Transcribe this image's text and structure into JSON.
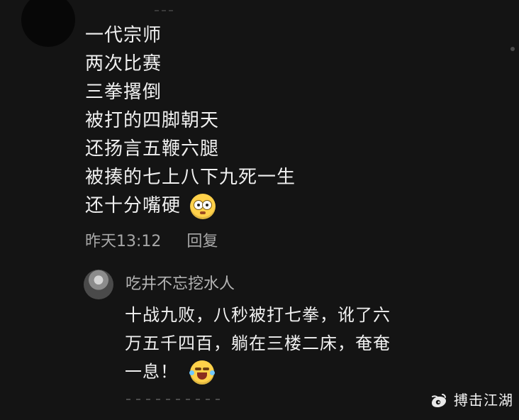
{
  "comment": {
    "lines": [
      "一代宗师",
      "两次比赛",
      "三拳撂倒",
      "被打的四脚朝天",
      "还扬言五鞭六腿",
      "被揍的七上八下九死一生",
      "还十分嘴硬"
    ],
    "time": "昨天13:12",
    "reply_action": "回复",
    "emoji": "smirk-face-icon"
  },
  "reply": {
    "name": "吃井不忘挖水人",
    "lines": [
      "十战九败，八秒被打七拳，讹了六",
      "万五千四百，躺在三楼二床，奄奄",
      "一息！"
    ],
    "emoji": "laugh-tears-icon"
  },
  "watermark": {
    "text": "搏击江湖",
    "icon": "weibo-icon"
  },
  "colors": {
    "background": "#141414",
    "primary_text": "#f0f0f0",
    "secondary_text": "#a8a8a8"
  }
}
